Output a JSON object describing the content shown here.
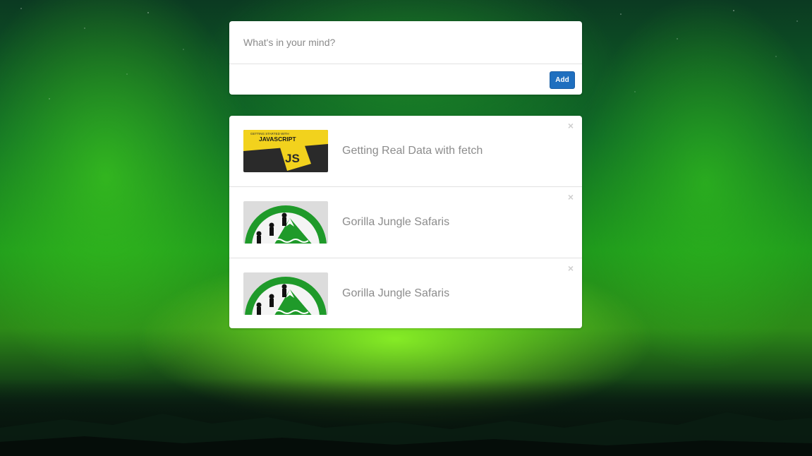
{
  "composer": {
    "placeholder": "What's in your mind?",
    "add_label": "Add"
  },
  "items": [
    {
      "title": "Getting Real Data with fetch",
      "thumbnail": "javascript-thumbnail",
      "thumb_text_top": "GETTING STARTED WITH",
      "thumb_text_main": "JAVASCRIPT",
      "thumb_badge": "JS"
    },
    {
      "title": "Gorilla Jungle Safaris",
      "thumbnail": "gorilla-safari-logo"
    },
    {
      "title": "Gorilla Jungle Safaris",
      "thumbnail": "gorilla-safari-logo"
    }
  ],
  "icons": {
    "delete": "close-icon"
  },
  "colors": {
    "accent": "#1f6fbf",
    "card": "#ffffff",
    "title_text": "#8c8c8c"
  }
}
